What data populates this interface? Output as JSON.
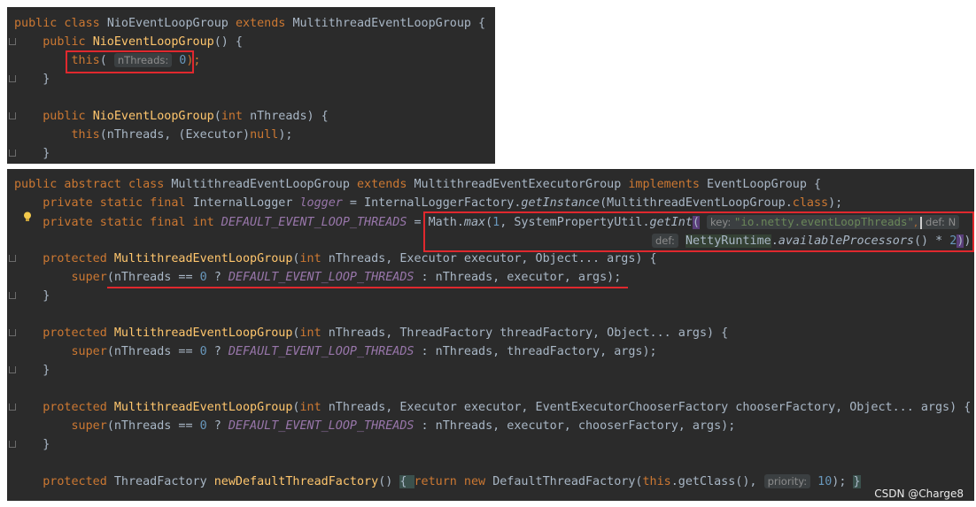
{
  "panel1": {
    "l1": {
      "a": "public class ",
      "b": "NioEventLoopGroup ",
      "c": "extends ",
      "d": "MultithreadEventLoopGroup {"
    },
    "l2": {
      "a": "public ",
      "b": "NioEventLoopGroup",
      "c": "() {"
    },
    "l3": {
      "a": "this",
      "b": "( ",
      "hint": "nThreads:",
      "c": " 0",
      "d": ");"
    },
    "l4": "}",
    "l6": {
      "a": "public ",
      "b": "NioEventLoopGroup",
      "c": "(",
      "d": "int ",
      "e": "nThreads) {"
    },
    "l7": {
      "a": "this",
      "b": "(nThreads, (Executor)",
      "c": "null",
      "d": ");"
    },
    "l8": "}"
  },
  "panel2": {
    "l1": {
      "a": "public abstract class ",
      "b": "MultithreadEventLoopGroup ",
      "c": "extends ",
      "d": "MultithreadEventExecutorGroup ",
      "e": "implements ",
      "f": "EventLoopGroup {"
    },
    "l2": {
      "a": "private static final ",
      "b": "InternalLogger ",
      "c": "logger",
      "d": " = InternalLoggerFactory.",
      "e": "getInstance",
      "f": "(MultithreadEventLoopGroup.",
      "g": "class",
      "h": ");"
    },
    "l3": {
      "a": "private static final int ",
      "b": "DEFAULT_EVENT_LOOP_THREADS",
      "c": " = ",
      "d": "Math.",
      "e": "max",
      "f": "(",
      "g": "1",
      "h": ", SystemPropertyUtil.",
      "i": "getInt",
      "j": "(",
      "hint_key": "key:",
      "str": "\"io.netty.eventLoopThreads\"",
      "k": ",",
      "hint_def": "def:",
      "l": "N"
    },
    "l4": {
      "hint_def": "def:",
      "a": "NettyRuntime",
      "b": ".",
      "c": "availableProcessors",
      "d": "() * ",
      "e": "2",
      "f": ")",
      ")": ");"
    },
    "l6": {
      "a": "protected ",
      "b": "MultithreadEventLoopGroup",
      "c": "(",
      "d": "int ",
      "e": "nThreads, Executor executor, Object... args) {"
    },
    "l7": {
      "a": "super",
      "b": "(nThreads == ",
      "c": "0",
      " d": " ? ",
      "e": "DEFAULT_EVENT_LOOP_THREADS",
      "f": " : nThreads, executor, args);"
    },
    "l8": "}",
    "l10": {
      "a": "protected ",
      "b": "MultithreadEventLoopGroup",
      "c": "(",
      "d": "int ",
      "e": "nThreads, ThreadFactory threadFactory, Object... args) {"
    },
    "l11": {
      "a": "super",
      "b": "(nThreads == ",
      "c": "0",
      "d": " ? ",
      "e": "DEFAULT_EVENT_LOOP_THREADS",
      "f": " : nThreads, threadFactory, args);"
    },
    "l12": "}",
    "l14": {
      "a": "protected ",
      "b": "MultithreadEventLoopGroup",
      "c": "(",
      "d": "int ",
      "e": "nThreads, Executor executor, EventExecutorChooserFactory chooserFactory, Object... args) {"
    },
    "l15": {
      "a": "super",
      "b": "(nThreads == ",
      "c": "0",
      "d": " ? ",
      "e": "DEFAULT_EVENT_LOOP_THREADS",
      "f": " : nThreads, executor, chooserFactory, args);"
    },
    "l16": "}",
    "l18": {
      "a": "protected ",
      "b": "ThreadFactory ",
      "c": "newDefaultThreadFactory",
      "d": "() ",
      "e": "{ ",
      "f": "return new ",
      "g": "DefaultThreadFactory(",
      "h": "this",
      "i": ".getClass(), ",
      "hint": "priority:",
      "j": " 10",
      "k": "); ",
      "l": "}"
    }
  },
  "watermark": "CSDN @Charge8",
  "colors": {
    "bg": "#2b2b2b",
    "keyword": "#cc7832",
    "method": "#ffc66d",
    "field": "#9876aa",
    "number": "#6897bb",
    "string": "#6a8759",
    "highlight": "#e0282e"
  }
}
